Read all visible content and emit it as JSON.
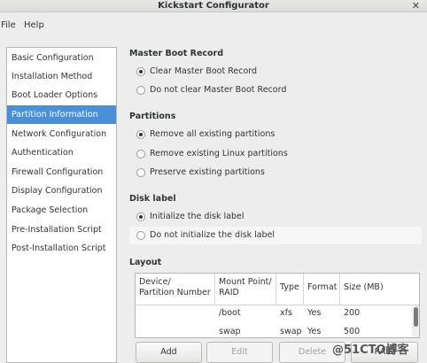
{
  "window": {
    "title": "Kickstart Configurator",
    "close_glyph": "✕"
  },
  "menu": [
    {
      "label": "File"
    },
    {
      "label": "Help"
    }
  ],
  "sidebar": {
    "items": [
      {
        "label": "Basic Configuration"
      },
      {
        "label": "Installation Method"
      },
      {
        "label": "Boot Loader Options"
      },
      {
        "label": "Partition Information",
        "selected": true
      },
      {
        "label": "Network Configuration"
      },
      {
        "label": "Authentication"
      },
      {
        "label": "Firewall Configuration"
      },
      {
        "label": "Display Configuration"
      },
      {
        "label": "Package Selection"
      },
      {
        "label": "Pre-Installation Script"
      },
      {
        "label": "Post-Installation Script"
      }
    ]
  },
  "mbr": {
    "title": "Master Boot Record",
    "options": [
      {
        "label": "Clear Master Boot Record",
        "checked": true
      },
      {
        "label": "Do not clear Master Boot Record",
        "checked": false
      }
    ]
  },
  "partitions": {
    "title": "Partitions",
    "options": [
      {
        "label": "Remove all existing partitions",
        "checked": true
      },
      {
        "label": "Remove existing Linux partitions",
        "checked": false
      },
      {
        "label": "Preserve existing partitions",
        "checked": false
      }
    ]
  },
  "disk_label": {
    "title": "Disk label",
    "options": [
      {
        "label": "Initialize the disk label",
        "checked": true
      },
      {
        "label": "Do not initialize the disk label",
        "checked": false
      }
    ]
  },
  "layout": {
    "title": "Layout",
    "columns": [
      {
        "label": "Device/\nPartition Number"
      },
      {
        "label": "Mount Point/\nRAID"
      },
      {
        "label": "Type"
      },
      {
        "label": "Format"
      },
      {
        "label": "Size (MB)"
      }
    ],
    "rows": [
      [
        "",
        "/boot",
        "xfs",
        "Yes",
        "200"
      ],
      [
        "",
        "swap",
        "swap",
        "Yes",
        "500"
      ]
    ]
  },
  "buttons": {
    "add": "Add",
    "edit": "Edit",
    "delete": "Delete",
    "raid": "RAID"
  },
  "watermark": "@51CTO博客"
}
